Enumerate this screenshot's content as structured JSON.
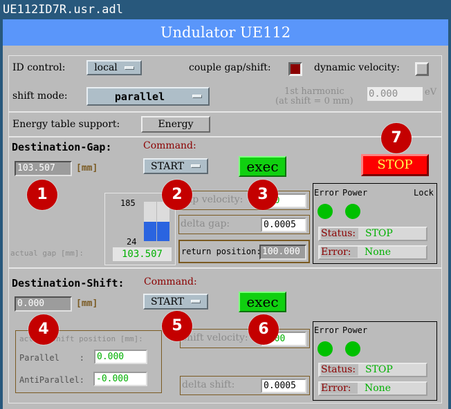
{
  "window": {
    "title": "UE112ID7R.usr.adl"
  },
  "banner": {
    "title": "Undulator UE112"
  },
  "top": {
    "id_control_label": "ID control:",
    "id_control_value": "local",
    "couple_label": "couple gap/shift:",
    "couple_checked": true,
    "dynamic_velocity_label": "dynamic velocity:",
    "dynamic_velocity_checked": false,
    "shift_mode_label": "shift mode:",
    "shift_mode_value": "parallel",
    "harmonic_label_line1": "1st harmonic",
    "harmonic_label_line2": "(at shift = 0 mm)",
    "harmonic_value": "0.000",
    "harmonic_unit": "eV"
  },
  "energy": {
    "label": "Energy table support:",
    "button": "Energy"
  },
  "gap": {
    "title": "Destination-Gap:",
    "command_label": "Command:",
    "command_value": "START",
    "exec_label": "exec",
    "destination_value": "103.507",
    "unit": "[mm]",
    "actual_label": "actual gap [mm]:",
    "bar_max": "185",
    "bar_min": "24",
    "bar_fraction": 0.49,
    "actual_value": "103.507",
    "velocity_label": "gap velocity:",
    "velocity_value": "200",
    "delta_label": "delta gap:",
    "delta_value": "0.0005",
    "return_label": "return position:",
    "return_value": "100.000",
    "status": {
      "error_label": "Error",
      "power_label": "Power",
      "lock_label": "Lock",
      "status_key": "Status:",
      "status_value": "STOP",
      "error_key": "Error:",
      "error_value": "None"
    }
  },
  "stop_button": "STOP",
  "shift": {
    "title": "Destination-Shift:",
    "command_label": "Command:",
    "command_value": "START",
    "exec_label": "exec",
    "destination_value": "0.000",
    "unit": "[mm]",
    "actual_label": "actual shift position [mm]:",
    "parallel_label": "Parallel    :",
    "parallel_value": "0.000",
    "antiparallel_label": "AntiParallel:",
    "antiparallel_value": "-0.000",
    "velocity_label": "shift velocity:",
    "velocity_value": "1200",
    "delta_label": "delta shift:",
    "delta_value": "0.0005",
    "status": {
      "error_label": "Error",
      "power_label": "Power",
      "status_key": "Status:",
      "status_value": "STOP",
      "error_key": "Error:",
      "error_value": "None"
    }
  },
  "badges": [
    "1",
    "2",
    "3",
    "4",
    "5",
    "6",
    "7"
  ],
  "colors": {
    "banner": "#5a96fa",
    "exec": "#10d010",
    "stop": "#fd0000",
    "indicator": "#00c000",
    "checked": "#8b0000"
  }
}
